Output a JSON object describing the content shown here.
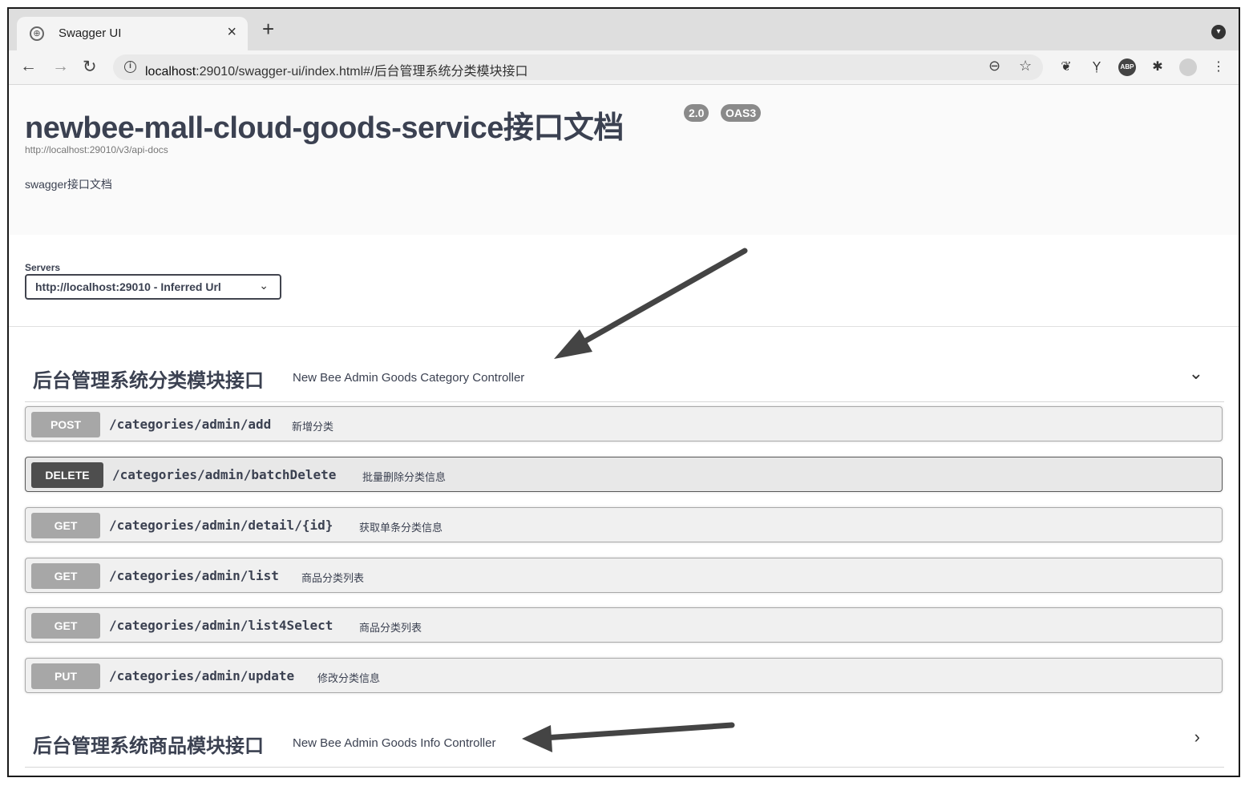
{
  "browser": {
    "tab_title": "Swagger UI",
    "tab_close": "×",
    "new_tab": "+",
    "url_host": "localhost",
    "url_rest": ":29010/swagger-ui/index.html#/后台管理系统分类模块接口",
    "ext_abp": "ABP"
  },
  "info": {
    "title": "newbee-mall-cloud-goods-service接口文档",
    "version_badge": "2.0",
    "oas_badge": "OAS3",
    "docs_url": "http://localhost:29010/v3/api-docs",
    "description": "swagger接口文档"
  },
  "servers": {
    "label": "Servers",
    "selected": "http://localhost:29010 - Inferred Url"
  },
  "tags": [
    {
      "name": "后台管理系统分类模块接口",
      "description": "New Bee Admin Goods Category Controller",
      "expanded": true,
      "operations": [
        {
          "method": "POST",
          "path": "/categories/admin/add",
          "summary": "新增分类"
        },
        {
          "method": "DELETE",
          "path": "/categories/admin/batchDelete",
          "summary": "批量删除分类信息"
        },
        {
          "method": "GET",
          "path": "/categories/admin/detail/{id}",
          "summary": "获取单条分类信息"
        },
        {
          "method": "GET",
          "path": "/categories/admin/list",
          "summary": "商品分类列表"
        },
        {
          "method": "GET",
          "path": "/categories/admin/list4Select",
          "summary": "商品分类列表"
        },
        {
          "method": "PUT",
          "path": "/categories/admin/update",
          "summary": "修改分类信息"
        }
      ]
    },
    {
      "name": "后台管理系统商品模块接口",
      "description": "New Bee Admin Goods Info Controller",
      "expanded": false
    }
  ],
  "colors": {
    "method_default": "#a7a7a7",
    "method_delete": "#4e4e4e",
    "text": "#3b4151"
  }
}
